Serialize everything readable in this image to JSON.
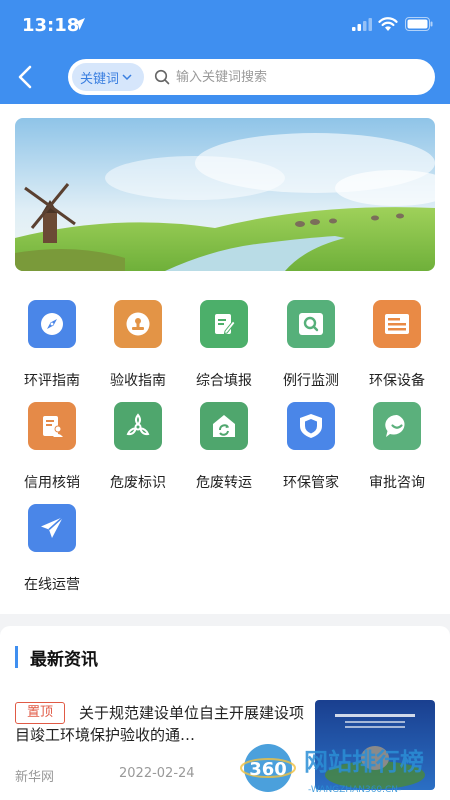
{
  "status": {
    "time": "13:18"
  },
  "search": {
    "selector_label": "关键词",
    "placeholder": "输入关键词搜索"
  },
  "grid": {
    "items": [
      {
        "label": "环评指南",
        "icon": "compass-icon",
        "color": "#4a86e8"
      },
      {
        "label": "验收指南",
        "icon": "stamp-icon",
        "color": "#e39446"
      },
      {
        "label": "综合填报",
        "icon": "edit-document-icon",
        "color": "#4caf6a"
      },
      {
        "label": "例行监测",
        "icon": "monitor-search-icon",
        "color": "#56b07a"
      },
      {
        "label": "环保设备",
        "icon": "equipment-list-icon",
        "color": "#e98a45"
      },
      {
        "label": "信用核销",
        "icon": "credit-document-icon",
        "color": "#e58a48"
      },
      {
        "label": "危废标识",
        "icon": "biohazard-icon",
        "color": "#4fa66d"
      },
      {
        "label": "危废转运",
        "icon": "recycle-house-icon",
        "color": "#4fa66d"
      },
      {
        "label": "环保管家",
        "icon": "shield-icon",
        "color": "#4a86e8"
      },
      {
        "label": "审批咨询",
        "icon": "chat-bubble-icon",
        "color": "#5bb07c"
      },
      {
        "label": "在线运营",
        "icon": "paper-plane-icon",
        "color": "#4a86e8"
      }
    ]
  },
  "news": {
    "section_title": "最新资讯",
    "items": [
      {
        "tag": "置顶",
        "headline": "关于规范建设单位自主开展建设项目竣工环境保护验收的通…",
        "source": "新华网",
        "date": "2022-02-24"
      }
    ]
  },
  "watermark": {
    "brand": "网站排行榜",
    "number": "360",
    "domain": "-WANGZHAN360.CN-"
  },
  "colors": {
    "primary": "#3f8ff0",
    "tag_red": "#e05a45"
  }
}
